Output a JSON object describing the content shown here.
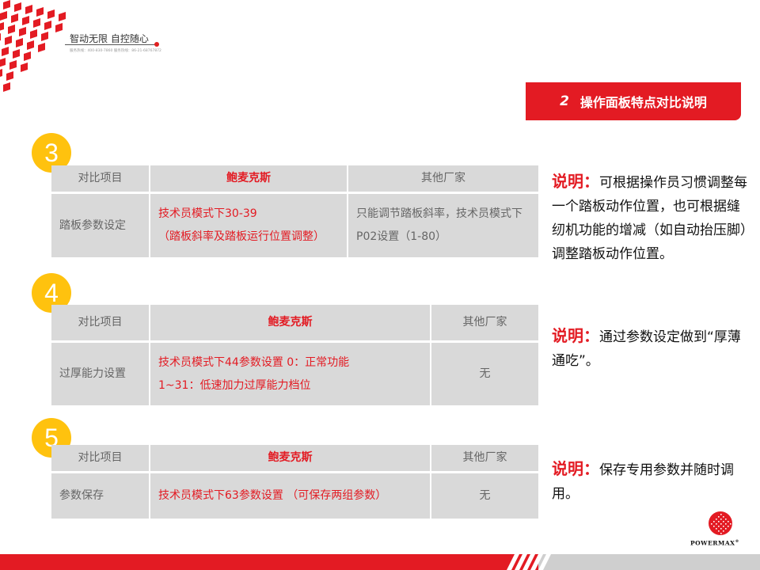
{
  "brand": {
    "slogan": "智动无限  自控随心",
    "hotline": "服务热线：400-830-7860  服务热线：86-21-68767872",
    "logo_text": "POWERMAX",
    "logo_mark": "®"
  },
  "section": {
    "number": "2",
    "title": "操作面板特点对比说明"
  },
  "colors": {
    "accent": "#e31b23",
    "circle": "#ffc20e",
    "cell": "#d9d9d9"
  },
  "tables": [
    {
      "index": "3",
      "header": [
        "对比项目",
        "鲍麦克斯",
        "其他厂家"
      ],
      "row": {
        "item": "踏板参数设定",
        "ours": "技术员模式下30-39\n（踏板斜率及踏板运行位置调整）",
        "others": "只能调节踏板斜率，技术员模式下P02设置（1-80）"
      }
    },
    {
      "index": "4",
      "header": [
        "对比项目",
        "鲍麦克斯",
        "其他厂家"
      ],
      "row": {
        "item": "过厚能力设置",
        "ours": "技术员模式下44参数设置 0：正常功能\n1~31：低速加力过厚能力档位",
        "others": "无"
      }
    },
    {
      "index": "5",
      "header": [
        "对比项目",
        "鲍麦克斯",
        "其他厂家"
      ],
      "row": {
        "item": "参数保存",
        "ours": "技术员模式下63参数设置 （可保存两组参数）",
        "others": "无"
      }
    }
  ],
  "notes": [
    {
      "label": "说明：",
      "text": "可根据操作员习惯调整每一个踏板动作位置，也可根据缝纫机功能的增减（如自动抬压脚）调整踏板动作位置。"
    },
    {
      "label": "说明：",
      "text": "通过参数设定做到“厚薄通吃”。"
    },
    {
      "label": "说明：",
      "text": "保存专用参数并随时调用。"
    }
  ]
}
